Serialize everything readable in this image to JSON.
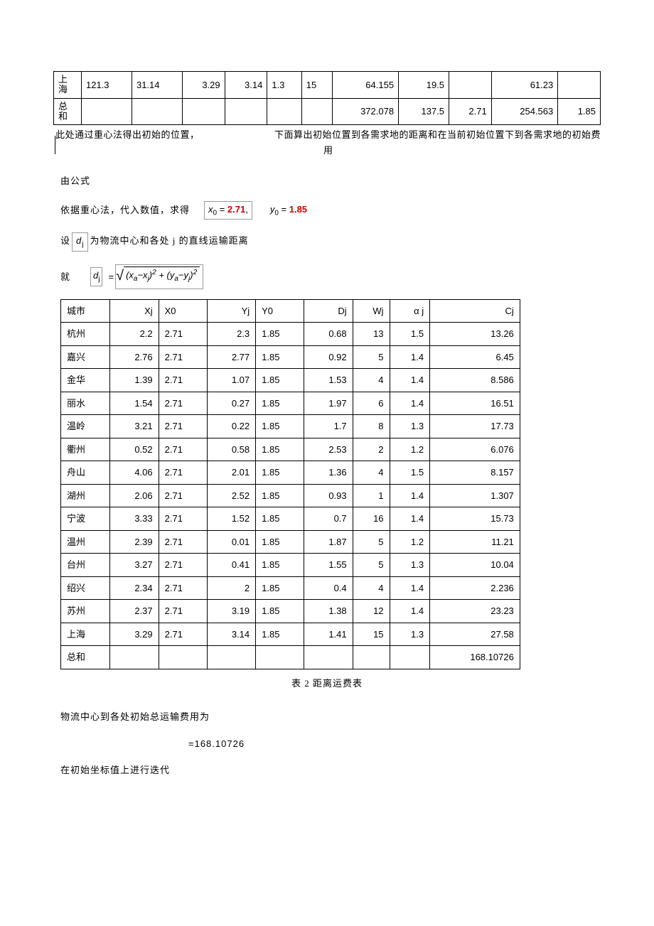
{
  "top_table": {
    "rows": [
      {
        "city": "上海",
        "c1": "121.3",
        "c2": "31.14",
        "c3": "3.29",
        "c4": "3.14",
        "c5": "1.3",
        "c6": "15",
        "c7": "64.155",
        "c8": "19.5",
        "c9": "",
        "c10": "61.23",
        "c11": ""
      },
      {
        "city": "总和",
        "c1": "",
        "c2": "",
        "c3": "",
        "c4": "",
        "c5": "",
        "c6": "",
        "c7": "372.078",
        "c8": "137.5",
        "c9": "2.71",
        "c10": "254.563",
        "c11": "1.85"
      }
    ]
  },
  "cap1_a": "此处通过重心法得出初始的位置，",
  "cap1_b": "下面算出初始位置到各需求地的距离和在当前初始位置下到各需求地的初始费",
  "cap1_c": "用",
  "p1": "由公式",
  "p2": "依据重心法，代入数值，求得",
  "x0_lhs": "x",
  "x0_sub": "0",
  "x0_val": "2.71",
  "y0_lhs": "y",
  "y0_sub": "0",
  "y0_val": "1.85",
  "p3a": "设",
  "p3_dj": "d",
  "p3_dj_sub": "j",
  "p3b": "为物流中心和各处    j  的直线运输距离",
  "p4": "就",
  "dj_lhs": "d",
  "dj_sub": "j",
  "sqrt_body_a": "(x",
  "sqrt_body_b": "a",
  "sqrt_body_c": "−x",
  "sqrt_body_d": "j",
  "sqrt_body_e": ")",
  "sqrt_body_p": "2",
  "sqrt_body_f": " + (y",
  "sqrt_body_g": "a",
  "sqrt_body_h": "−y",
  "sqrt_body_i": "j",
  "sqrt_body_j": ")",
  "main_table": {
    "headers": [
      "城市",
      "Xj",
      "X0",
      "Yj",
      "Y0",
      "Dj",
      "Wj",
      "α j",
      "Cj"
    ],
    "rows": [
      {
        "city": "杭州",
        "xj": "2.2",
        "x0": "2.71",
        "yj": "2.3",
        "y0": "1.85",
        "dj": "0.68",
        "wj": "13",
        "aj": "1.5",
        "cj": "13.26"
      },
      {
        "city": "嘉兴",
        "xj": "2.76",
        "x0": "2.71",
        "yj": "2.77",
        "y0": "1.85",
        "dj": "0.92",
        "wj": "5",
        "aj": "1.4",
        "cj": "6.45"
      },
      {
        "city": "金华",
        "xj": "1.39",
        "x0": "2.71",
        "yj": "1.07",
        "y0": "1.85",
        "dj": "1.53",
        "wj": "4",
        "aj": "1.4",
        "cj": "8.586"
      },
      {
        "city": "丽水",
        "xj": "1.54",
        "x0": "2.71",
        "yj": "0.27",
        "y0": "1.85",
        "dj": "1.97",
        "wj": "6",
        "aj": "1.4",
        "cj": "16.51"
      },
      {
        "city": "温岭",
        "xj": "3.21",
        "x0": "2.71",
        "yj": "0.22",
        "y0": "1.85",
        "dj": "1.7",
        "wj": "8",
        "aj": "1.3",
        "cj": "17.73"
      },
      {
        "city": "衢州",
        "xj": "0.52",
        "x0": "2.71",
        "yj": "0.58",
        "y0": "1.85",
        "dj": "2.53",
        "wj": "2",
        "aj": "1.2",
        "cj": "6.076"
      },
      {
        "city": "舟山",
        "xj": "4.06",
        "x0": "2.71",
        "yj": "2.01",
        "y0": "1.85",
        "dj": "1.36",
        "wj": "4",
        "aj": "1.5",
        "cj": "8.157"
      },
      {
        "city": "湖州",
        "xj": "2.06",
        "x0": "2.71",
        "yj": "2.52",
        "y0": "1.85",
        "dj": "0.93",
        "wj": "1",
        "aj": "1.4",
        "cj": "1.307"
      },
      {
        "city": "宁波",
        "xj": "3.33",
        "x0": "2.71",
        "yj": "1.52",
        "y0": "1.85",
        "dj": "0.7",
        "wj": "16",
        "aj": "1.4",
        "cj": "15.73"
      },
      {
        "city": "温州",
        "xj": "2.39",
        "x0": "2.71",
        "yj": "0.01",
        "y0": "1.85",
        "dj": "1.87",
        "wj": "5",
        "aj": "1.2",
        "cj": "11.21"
      },
      {
        "city": "台州",
        "xj": "3.27",
        "x0": "2.71",
        "yj": "0.41",
        "y0": "1.85",
        "dj": "1.55",
        "wj": "5",
        "aj": "1.3",
        "cj": "10.04"
      },
      {
        "city": "绍兴",
        "xj": "2.34",
        "x0": "2.71",
        "yj": "2",
        "y0": "1.85",
        "dj": "0.4",
        "wj": "4",
        "aj": "1.4",
        "cj": "2.236"
      },
      {
        "city": "苏州",
        "xj": "2.37",
        "x0": "2.71",
        "yj": "3.19",
        "y0": "1.85",
        "dj": "1.38",
        "wj": "12",
        "aj": "1.4",
        "cj": "23.23"
      },
      {
        "city": "上海",
        "xj": "3.29",
        "x0": "2.71",
        "yj": "3.14",
        "y0": "1.85",
        "dj": "1.41",
        "wj": "15",
        "aj": "1.3",
        "cj": "27.58"
      }
    ],
    "total_label": "总和",
    "total_cj": "168.10726"
  },
  "cap2": "表 2  距离运费表",
  "p5": "物流中心到各处初始总运输费用为",
  "result": "=168.10726",
  "p6": "在初始坐标值上进行迭代"
}
